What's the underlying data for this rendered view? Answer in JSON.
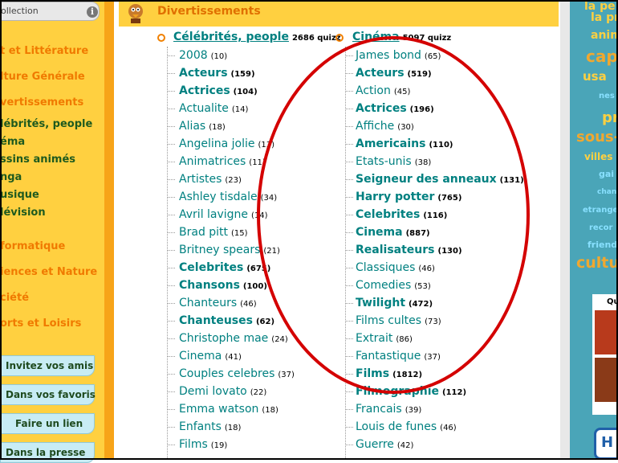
{
  "sidebar": {
    "collection_label": "ollection",
    "info_icon": "info-icon",
    "categories": [
      {
        "label": "t et Littérature",
        "type": "cat"
      },
      {
        "label": "lture Générale",
        "type": "cat"
      },
      {
        "label": "vertissements",
        "type": "cat"
      },
      {
        "label": "lébrités, people",
        "type": "sub"
      },
      {
        "label": "éma",
        "type": "sub"
      },
      {
        "label": "ssins animés",
        "type": "sub"
      },
      {
        "label": "nga",
        "type": "sub"
      },
      {
        "label": "usique",
        "type": "sub"
      },
      {
        "label": "lévision",
        "type": "sub"
      },
      {
        "label": "formatique",
        "type": "cat"
      },
      {
        "label": "iences et Nature",
        "type": "cat"
      },
      {
        "label": "ciété",
        "type": "cat"
      },
      {
        "label": "orts et Loisirs",
        "type": "cat"
      }
    ],
    "buttons": [
      {
        "label": "Invitez vos amis"
      },
      {
        "label": "Dans vos favoris"
      },
      {
        "label": "Faire un lien"
      },
      {
        "label": "Dans la presse"
      }
    ]
  },
  "main": {
    "title": "Divertissements",
    "col1": {
      "heading": "Célébrités, people",
      "count": "2686 quizz",
      "items": [
        {
          "name": "2008",
          "count": "(10)",
          "bold": false
        },
        {
          "name": "Acteurs",
          "count": "(159)",
          "bold": true
        },
        {
          "name": "Actrices",
          "count": "(104)",
          "bold": true
        },
        {
          "name": "Actualite",
          "count": "(14)",
          "bold": false
        },
        {
          "name": "Alias",
          "count": "(18)",
          "bold": false
        },
        {
          "name": "Angelina jolie",
          "count": "(13)",
          "bold": false
        },
        {
          "name": "Animatrices",
          "count": "(11)",
          "bold": false
        },
        {
          "name": "Artistes",
          "count": "(23)",
          "bold": false
        },
        {
          "name": "Ashley tisdale",
          "count": "(34)",
          "bold": false
        },
        {
          "name": "Avril lavigne",
          "count": "(14)",
          "bold": false
        },
        {
          "name": "Brad pitt",
          "count": "(15)",
          "bold": false
        },
        {
          "name": "Britney spears",
          "count": "(21)",
          "bold": false
        },
        {
          "name": "Celebrites",
          "count": "(675)",
          "bold": true
        },
        {
          "name": "Chansons",
          "count": "(100)",
          "bold": true
        },
        {
          "name": "Chanteurs",
          "count": "(46)",
          "bold": false
        },
        {
          "name": "Chanteuses",
          "count": "(62)",
          "bold": true
        },
        {
          "name": "Christophe mae",
          "count": "(24)",
          "bold": false
        },
        {
          "name": "Cinema",
          "count": "(41)",
          "bold": false
        },
        {
          "name": "Couples celebres",
          "count": "(37)",
          "bold": false
        },
        {
          "name": "Demi lovato",
          "count": "(22)",
          "bold": false
        },
        {
          "name": "Emma watson",
          "count": "(18)",
          "bold": false
        },
        {
          "name": "Enfants",
          "count": "(18)",
          "bold": false
        },
        {
          "name": "Films",
          "count": "(19)",
          "bold": false
        }
      ]
    },
    "col2": {
      "heading": "Cinéma",
      "count": "5097 quizz",
      "items": [
        {
          "name": "James bond",
          "count": "(65)",
          "bold": false
        },
        {
          "name": "Acteurs",
          "count": "(519)",
          "bold": true
        },
        {
          "name": "Action",
          "count": "(45)",
          "bold": false
        },
        {
          "name": "Actrices",
          "count": "(196)",
          "bold": true
        },
        {
          "name": "Affiche",
          "count": "(30)",
          "bold": false
        },
        {
          "name": "Americains",
          "count": "(110)",
          "bold": true
        },
        {
          "name": "Etats-unis",
          "count": "(38)",
          "bold": false
        },
        {
          "name": "Seigneur des anneaux",
          "count": "(131)",
          "bold": true
        },
        {
          "name": "Harry potter",
          "count": "(765)",
          "bold": true
        },
        {
          "name": "Celebrites",
          "count": "(116)",
          "bold": true
        },
        {
          "name": "Cinema",
          "count": "(887)",
          "bold": true
        },
        {
          "name": "Realisateurs",
          "count": "(130)",
          "bold": true
        },
        {
          "name": "Classiques",
          "count": "(46)",
          "bold": false
        },
        {
          "name": "Comedies",
          "count": "(53)",
          "bold": false
        },
        {
          "name": "Twilight",
          "count": "(472)",
          "bold": true
        },
        {
          "name": "Films cultes",
          "count": "(73)",
          "bold": false
        },
        {
          "name": "Extrait",
          "count": "(86)",
          "bold": false
        },
        {
          "name": "Fantastique",
          "count": "(37)",
          "bold": false
        },
        {
          "name": "Films",
          "count": "(1812)",
          "bold": true
        },
        {
          "name": "Filmographie",
          "count": "(112)",
          "bold": true
        },
        {
          "name": "Francais",
          "count": "(39)",
          "bold": false
        },
        {
          "name": "Louis de funes",
          "count": "(46)",
          "bold": false
        },
        {
          "name": "Guerre",
          "count": "(42)",
          "bold": false
        }
      ]
    }
  },
  "tag_cloud": {
    "tags": [
      {
        "text": "la pe",
        "color": "#ffd040"
      },
      {
        "text": "la pr",
        "color": "#ffd040"
      },
      {
        "text": "anim",
        "color": "#ffd040"
      },
      {
        "text": "cap",
        "color": "#f0a830"
      },
      {
        "text": "usa",
        "color": "#ffd040"
      },
      {
        "text": "nes",
        "color": "#88e0ff"
      },
      {
        "text": "pr",
        "color": "#ffd040"
      },
      {
        "text": "sous-",
        "color": "#f0a830"
      },
      {
        "text": "villes",
        "color": "#ffd040"
      },
      {
        "text": "gai",
        "color": "#88e0ff"
      },
      {
        "text": "chan",
        "color": "#88e0ff"
      },
      {
        "text": "etrange",
        "color": "#88e0ff"
      },
      {
        "text": "recor",
        "color": "#88e0ff"
      },
      {
        "text": "friend",
        "color": "#88e0ff"
      },
      {
        "text": "cultu",
        "color": "#f0a830"
      }
    ],
    "thumb_title": "Qu"
  },
  "annotation": {
    "color": "#d40000"
  },
  "colors": {
    "accent": "#008080",
    "header": "#ffd040",
    "category": "#f07a00"
  }
}
